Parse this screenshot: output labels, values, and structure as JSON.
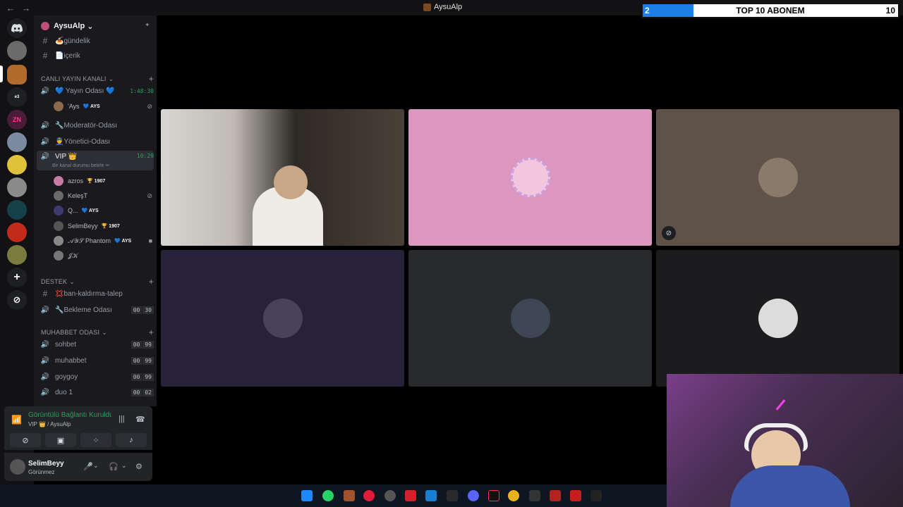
{
  "window": {
    "title": "AysuAlp"
  },
  "sub_goal": {
    "label": "TOP 10 ABONEM",
    "current": "2",
    "goal": "10",
    "progress": 0.2
  },
  "server": {
    "name": "AysuAlp"
  },
  "channels": {
    "top": [
      {
        "name": "🍝gündelik"
      },
      {
        "name": "📄içerik"
      }
    ],
    "cat_live": "CANLI YAYIN KANALI",
    "yayin": {
      "name": "💙 Yayın Odası 💙",
      "timer": "1:48:30"
    },
    "yayin_user": {
      "name": "'Ays",
      "tag": "💙 AYS"
    },
    "moderator": {
      "name": "🔧Moderatör-Odası"
    },
    "yonetici": {
      "name": "👮Yönetici-Odası"
    },
    "vip": {
      "name": "VIP 👑",
      "timer": "10:29",
      "status": "Bir kanal durumu belirle ✏"
    },
    "vip_users": [
      {
        "name": "azros",
        "tag": "🏆 1907",
        "color": "#c97aa6"
      },
      {
        "name": "KeleşT",
        "tag": "",
        "color": "#6a6a6a"
      },
      {
        "name": "Q...",
        "tag": "💙 AYS",
        "color": "#3b3b70"
      },
      {
        "name": "SelimBeyy",
        "tag": "🏆 1907",
        "color": "#555555"
      },
      {
        "name": "𝒜𝒴𝒮 Phantom",
        "tag": "💙 AYS",
        "color": "#888888"
      },
      {
        "name": "𝒥𝒦",
        "tag": "",
        "color": "#777777"
      }
    ],
    "cat_destek": "DESTEK",
    "ban": {
      "name": "💢ban-kaldırma-talep"
    },
    "bekleme": {
      "name": "🔧Bekleme Odası",
      "c1": "00",
      "c2": "30"
    },
    "cat_muhabbet": "MUHABBET ODASI",
    "muhabbet": [
      {
        "name": "sohbet",
        "c1": "00",
        "c2": "99"
      },
      {
        "name": "muhabbet",
        "c1": "00",
        "c2": "99"
      },
      {
        "name": "goygoy",
        "c1": "00",
        "c2": "99"
      },
      {
        "name": "duo 1",
        "c1": "00",
        "c2": "02"
      }
    ]
  },
  "voice": {
    "status": "Görüntülü Bağlantı Kuruldu",
    "location": "VIP 👑 / AysuAlp"
  },
  "user": {
    "name": "SelimBeyy",
    "status": "Görünmez"
  },
  "colors": {
    "accent_green": "#23a55a",
    "sidebar_bg": "#1a1a1e",
    "rail_bg": "#121214",
    "tile_pink": "#dc97c0",
    "tile_taupe": "#5e5249",
    "tile_indigo": "#272239",
    "tile_dark": "#282a2d",
    "tile_black": "#1c1c1e"
  }
}
